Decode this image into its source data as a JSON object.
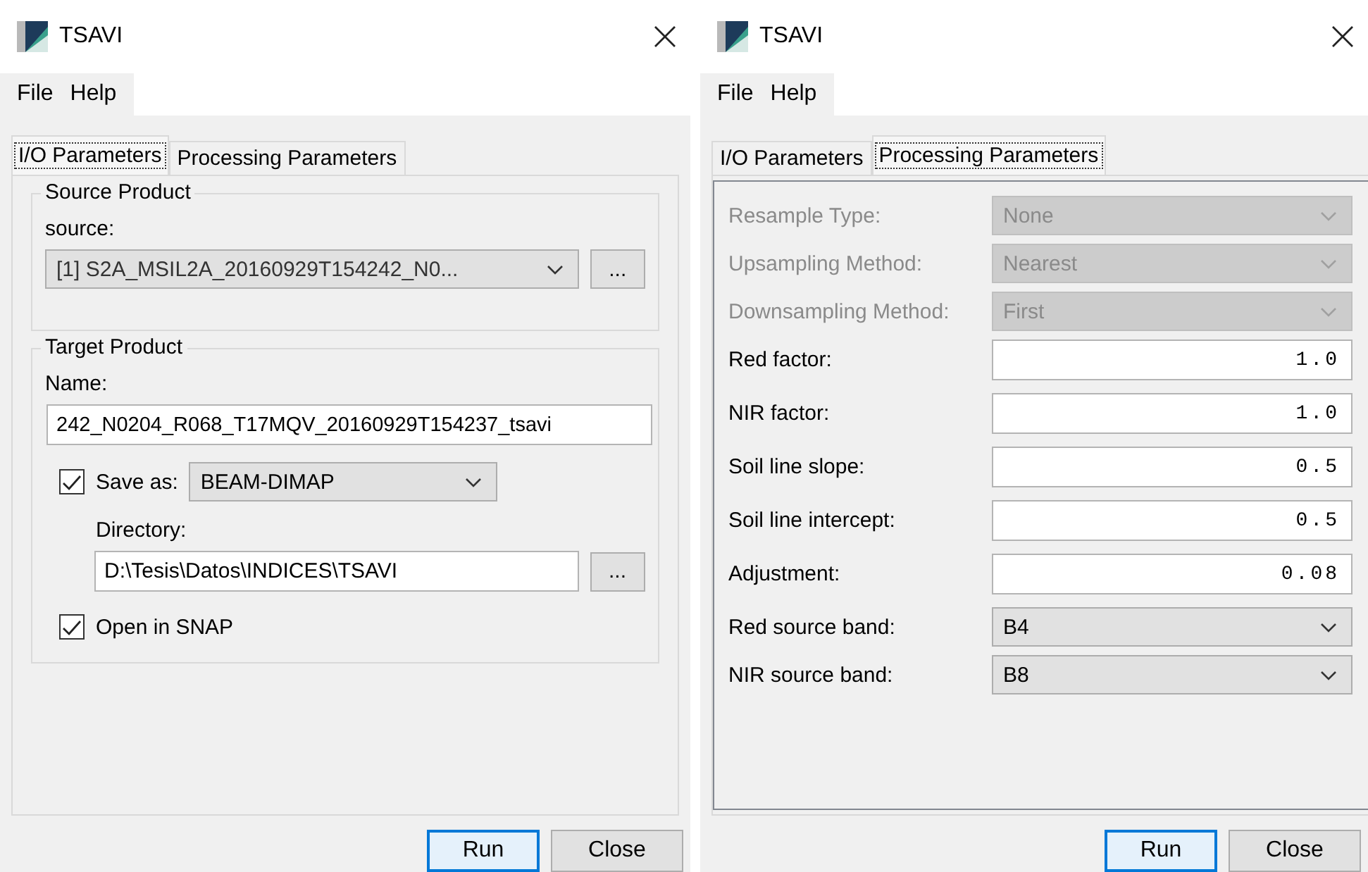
{
  "windows": [
    {
      "kind": "io",
      "title": "TSAVI",
      "menu": [
        "File",
        "Help"
      ],
      "tabs": [
        {
          "label": "I/O Parameters",
          "selected": true
        },
        {
          "label": "Processing Parameters",
          "selected": false
        }
      ],
      "source_product": {
        "title": "Source Product",
        "source_label": "source:",
        "source_value": "[1] S2A_MSIL2A_20160929T154242_N0...",
        "browse": "..."
      },
      "target_product": {
        "title": "Target Product",
        "name_label": "Name:",
        "name_value": "242_N0204_R068_T17MQV_20160929T154237_tsavi",
        "save_as": {
          "label": "Save as:",
          "checked": true,
          "format": "BEAM-DIMAP"
        },
        "directory_label": "Directory:",
        "directory_value": "D:\\Tesis\\Datos\\INDICES\\TSAVI",
        "browse": "...",
        "open_in_snap": {
          "label": "Open in SNAP",
          "checked": true
        }
      },
      "buttons": [
        {
          "label": "Run",
          "default": true
        },
        {
          "label": "Close",
          "default": false
        }
      ]
    },
    {
      "kind": "processing",
      "title": "TSAVI",
      "menu": [
        "File",
        "Help"
      ],
      "tabs": [
        {
          "label": "I/O Parameters",
          "selected": false
        },
        {
          "label": "Processing Parameters",
          "selected": true
        }
      ],
      "params": [
        {
          "kind": "combo",
          "label": "Resample Type:",
          "value": "None",
          "disabled": true
        },
        {
          "kind": "combo",
          "label": "Upsampling Method:",
          "value": "Nearest",
          "disabled": true
        },
        {
          "kind": "combo",
          "label": "Downsampling Method:",
          "value": "First",
          "disabled": true
        },
        {
          "kind": "text",
          "label": "Red factor:",
          "value": "1.0",
          "disabled": false
        },
        {
          "kind": "text",
          "label": "NIR factor:",
          "value": "1.0",
          "disabled": false
        },
        {
          "kind": "text",
          "label": "Soil line slope:",
          "value": "0.5",
          "disabled": false
        },
        {
          "kind": "text",
          "label": "Soil line intercept:",
          "value": "0.5",
          "disabled": false
        },
        {
          "kind": "text",
          "label": "Adjustment:",
          "value": "0.08",
          "disabled": false
        },
        {
          "kind": "combo",
          "label": "Red source band:",
          "value": "B4",
          "disabled": false
        },
        {
          "kind": "combo",
          "label": "NIR source band:",
          "value": "B8",
          "disabled": false
        }
      ],
      "buttons": [
        {
          "label": "Run",
          "default": true
        },
        {
          "label": "Close",
          "default": false
        }
      ]
    }
  ]
}
